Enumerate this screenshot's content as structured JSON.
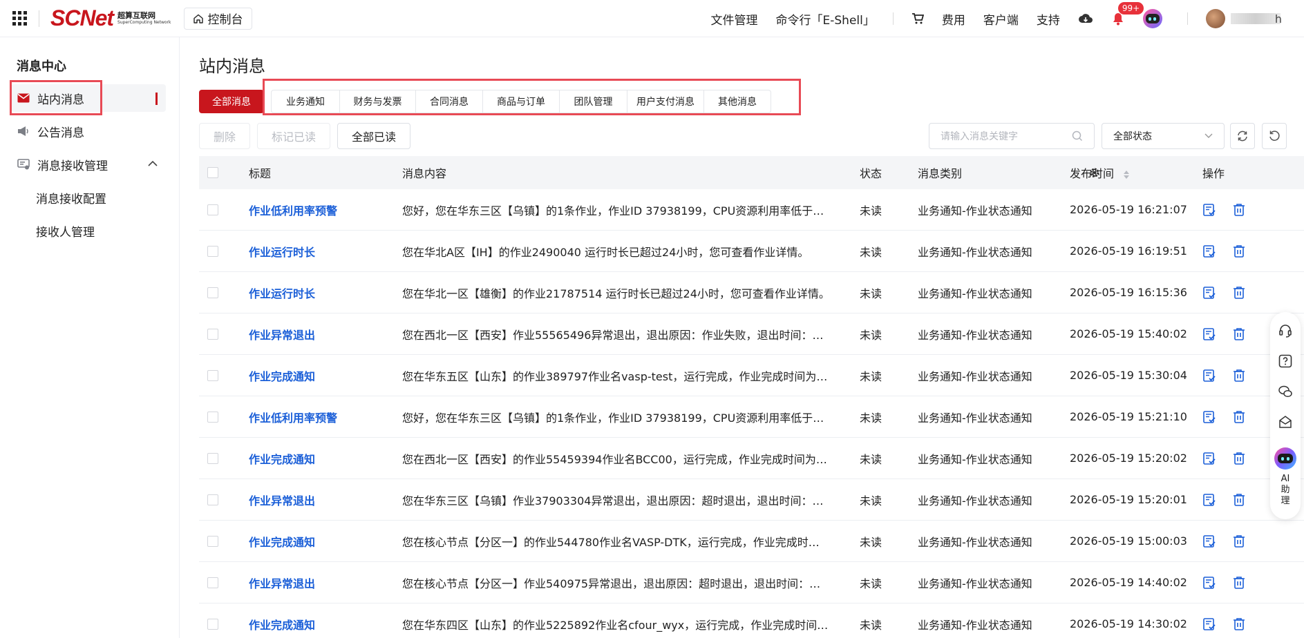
{
  "topbar": {
    "logo_text": "SCNet",
    "logo_cn": "超算互联网",
    "logo_en": "SuperComputing Network",
    "console": "控制台",
    "links": [
      "文件管理",
      "命令行「E-Shell」"
    ],
    "fee": "费用",
    "client": "客户端",
    "support": "支持",
    "badge": "99+",
    "user_tail": "h"
  },
  "sidebar": {
    "title": "消息中心",
    "items": [
      {
        "label": "站内消息",
        "icon": "mail-icon"
      },
      {
        "label": "公告消息",
        "icon": "megaphone-icon"
      },
      {
        "label": "消息接收管理",
        "icon": "settings-icon"
      }
    ],
    "sub_items": [
      "消息接收配置",
      "接收人管理"
    ]
  },
  "page": {
    "title": "站内消息",
    "tabs": [
      "全部消息",
      "业务通知",
      "财务与发票",
      "合同消息",
      "商品与订单",
      "团队管理",
      "用户支付消息",
      "其他消息"
    ],
    "actions": {
      "delete": "删除",
      "mark_read": "标记已读",
      "all_read": "全部已读"
    },
    "search_placeholder": "请输入消息关键字",
    "status_filter": "全部状态"
  },
  "table": {
    "columns": [
      "标题",
      "消息内容",
      "状态",
      "消息类别",
      "发布时间",
      "操作"
    ],
    "rows": [
      {
        "title": "作业低利用率预警",
        "content": "您好，您在华东三区【乌镇】的1条作业，作业ID 37938199，CPU资源利用率低于…",
        "status": "未读",
        "category": "业务通知-作业状态通知",
        "time": "2026-05-19 16:21:07"
      },
      {
        "title": "作业运行时长",
        "content": "您在华北A区【IH】的作业2490040 运行时长已超过24小时，您可查看作业详情。",
        "status": "未读",
        "category": "业务通知-作业状态通知",
        "time": "2026-05-19 16:19:51"
      },
      {
        "title": "作业运行时长",
        "content": "您在华北一区【雄衡】的作业21787514 运行时长已超过24小时，您可查看作业详情。",
        "status": "未读",
        "category": "业务通知-作业状态通知",
        "time": "2026-05-19 16:15:36"
      },
      {
        "title": "作业异常退出",
        "content": "您在西北一区【西安】作业55565496异常退出，退出原因：作业失败，退出时间：…",
        "status": "未读",
        "category": "业务通知-作业状态通知",
        "time": "2026-05-19 15:40:02"
      },
      {
        "title": "作业完成通知",
        "content": "您在华东五区【山东】的作业389797作业名vasp-test，运行完成，作业完成时间为…",
        "status": "未读",
        "category": "业务通知-作业状态通知",
        "time": "2026-05-19 15:30:04"
      },
      {
        "title": "作业低利用率预警",
        "content": "您好，您在华东三区【乌镇】的1条作业，作业ID 37938199，CPU资源利用率低于…",
        "status": "未读",
        "category": "业务通知-作业状态通知",
        "time": "2026-05-19 15:21:10"
      },
      {
        "title": "作业完成通知",
        "content": "您在西北一区【西安】的作业55459394作业名BCC00，运行完成，作业完成时间为…",
        "status": "未读",
        "category": "业务通知-作业状态通知",
        "time": "2026-05-19 15:20:02"
      },
      {
        "title": "作业异常退出",
        "content": "您在华东三区【乌镇】作业37903304异常退出，退出原因：超时退出，退出时间：…",
        "status": "未读",
        "category": "业务通知-作业状态通知",
        "time": "2026-05-19 15:20:01"
      },
      {
        "title": "作业完成通知",
        "content": "您在核心节点【分区一】的作业544780作业名VASP-DTK，运行完成，作业完成时…",
        "status": "未读",
        "category": "业务通知-作业状态通知",
        "time": "2026-05-19 15:00:03"
      },
      {
        "title": "作业异常退出",
        "content": "您在核心节点【分区一】作业540975异常退出，退出原因：超时退出，退出时间：…",
        "status": "未读",
        "category": "业务通知-作业状态通知",
        "time": "2026-05-19 14:40:02"
      },
      {
        "title": "作业完成通知",
        "content": "您在华东四区【山东】的作业5225892作业名cfour_wyx，运行完成，作业完成时间…",
        "status": "未读",
        "category": "业务通知-作业状态通知",
        "time": "2026-05-19 14:30:02"
      }
    ]
  },
  "float_bar": {
    "ai_label": "AI助理"
  },
  "colors": {
    "brand": "#c8161d",
    "link": "#1b5fd8",
    "unread_dot": "#ff8a1a",
    "highlight": "#e84a55"
  }
}
